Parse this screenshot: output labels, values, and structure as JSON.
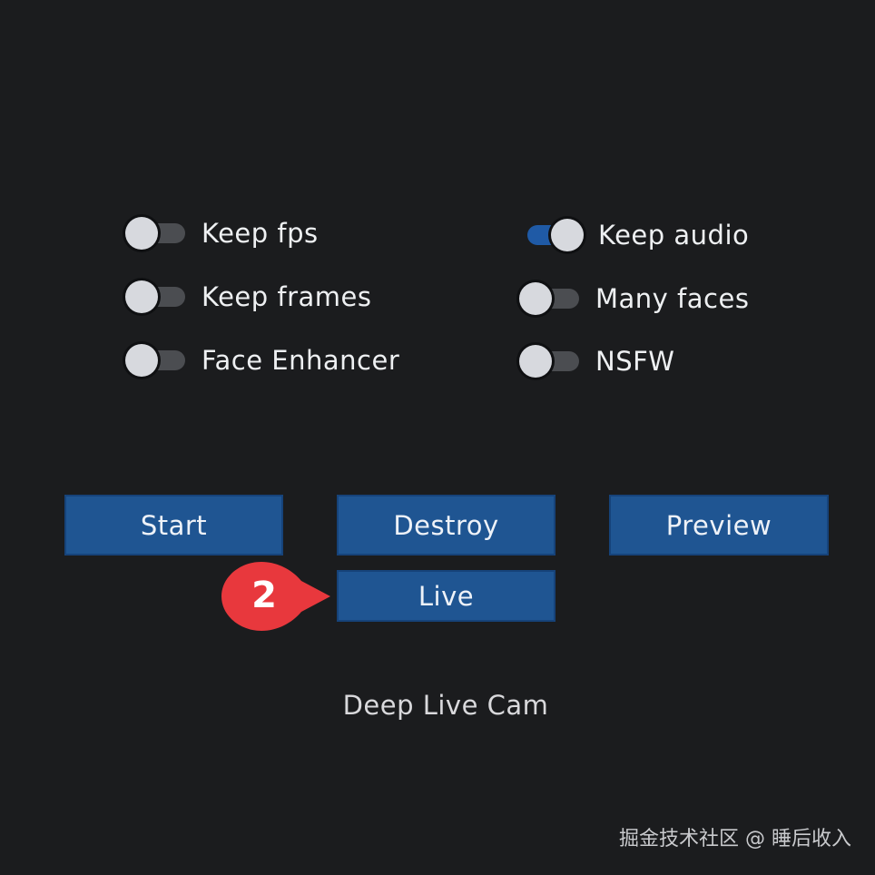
{
  "switches": [
    {
      "label": "Keep fps",
      "on": false
    },
    {
      "label": "Keep frames",
      "on": false
    },
    {
      "label": "Face Enhancer",
      "on": false
    },
    {
      "label": "Keep audio",
      "on": true
    },
    {
      "label": "Many faces",
      "on": false
    },
    {
      "label": "NSFW",
      "on": false
    }
  ],
  "buttons": {
    "start": "Start",
    "destroy": "Destroy",
    "preview": "Preview",
    "live": "Live"
  },
  "annotation": {
    "step_number": "2",
    "color": "#e8383d"
  },
  "app_title": "Deep Live Cam",
  "watermark": "掘金技术社区 @ 睡后收入",
  "colors": {
    "background": "#1b1c1e",
    "button": "#1f5592",
    "switch_on": "#1f5aa6",
    "switch_off": "#4b4d51"
  }
}
